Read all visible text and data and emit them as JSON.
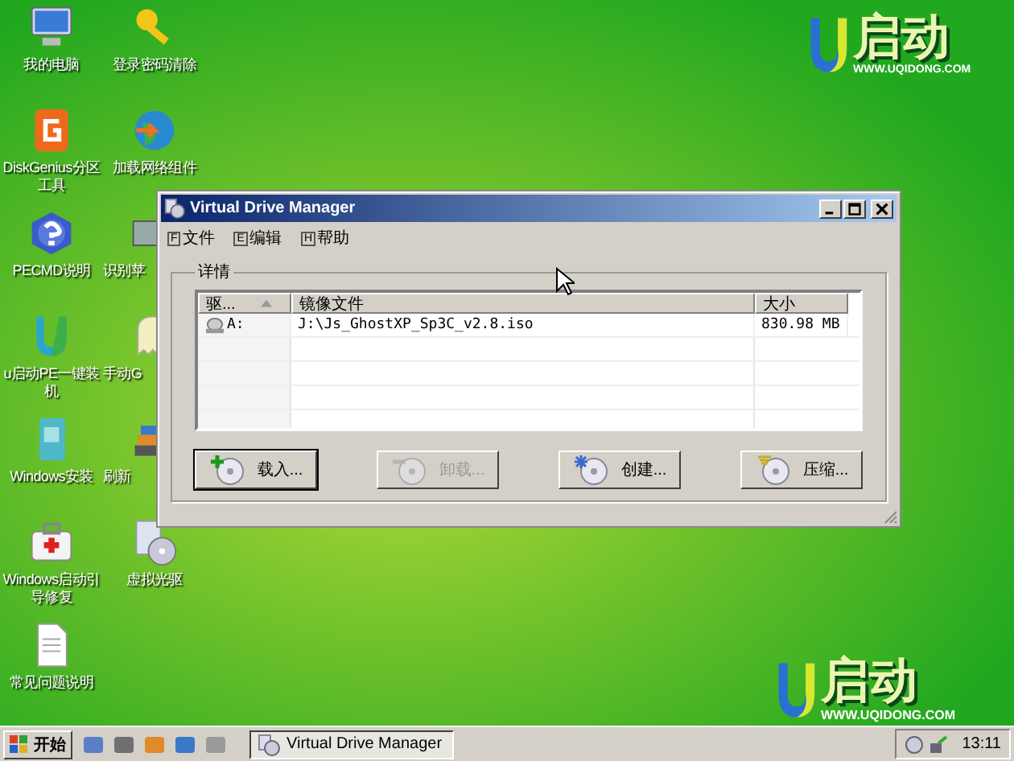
{
  "desktop_icons": [
    {
      "label": "我的电脑",
      "kind": "computer"
    },
    {
      "label": "登录密码清除",
      "kind": "key"
    },
    {
      "label": "DiskGenius分区工具",
      "kind": "dg"
    },
    {
      "label": "加载网络组件",
      "kind": "globe"
    },
    {
      "label": "PECMD说明",
      "kind": "help"
    },
    {
      "label": "识别苹",
      "kind": "drive"
    },
    {
      "label": "u启动PE一键装机",
      "kind": "u"
    },
    {
      "label": "手动G",
      "kind": "ghost"
    },
    {
      "label": "Windows安装",
      "kind": "book"
    },
    {
      "label": "刷新",
      "kind": "stack"
    },
    {
      "label": "Windows启动引导修复",
      "kind": "kit"
    },
    {
      "label": "虚拟光驱",
      "kind": "disc"
    },
    {
      "label": "常见问题说明",
      "kind": "doc"
    }
  ],
  "logos": [
    {
      "brand": "启动",
      "url": "WWW.UQIDONG.COM"
    },
    {
      "brand": "启动",
      "url": "WWW.UQIDONG.COM"
    }
  ],
  "window": {
    "title": "Virtual Drive Manager",
    "menu": [
      {
        "key": "F",
        "label": "文件"
      },
      {
        "key": "E",
        "label": "编辑"
      },
      {
        "key": "H",
        "label": "帮助"
      }
    ],
    "group": "详情",
    "columns": [
      {
        "label": "驱...",
        "sorted": true
      },
      {
        "label": "镜像文件",
        "sorted": false
      },
      {
        "label": "大小",
        "sorted": false
      }
    ],
    "rows": [
      {
        "drive": "A:",
        "file": "J:\\Js_GhostXP_Sp3C_v2.8.iso",
        "size": "830.98 MB"
      }
    ],
    "buttons": [
      {
        "label": "载入...",
        "kind": "load",
        "disabled": false,
        "default": true
      },
      {
        "label": "卸载...",
        "kind": "unload",
        "disabled": true,
        "default": false
      },
      {
        "label": "创建...",
        "kind": "create",
        "disabled": false,
        "default": false
      },
      {
        "label": "压缩...",
        "kind": "compress",
        "disabled": false,
        "default": false
      }
    ]
  },
  "taskbar": {
    "start": "开始",
    "task": "Virtual Drive Manager",
    "clock": "13:11"
  }
}
